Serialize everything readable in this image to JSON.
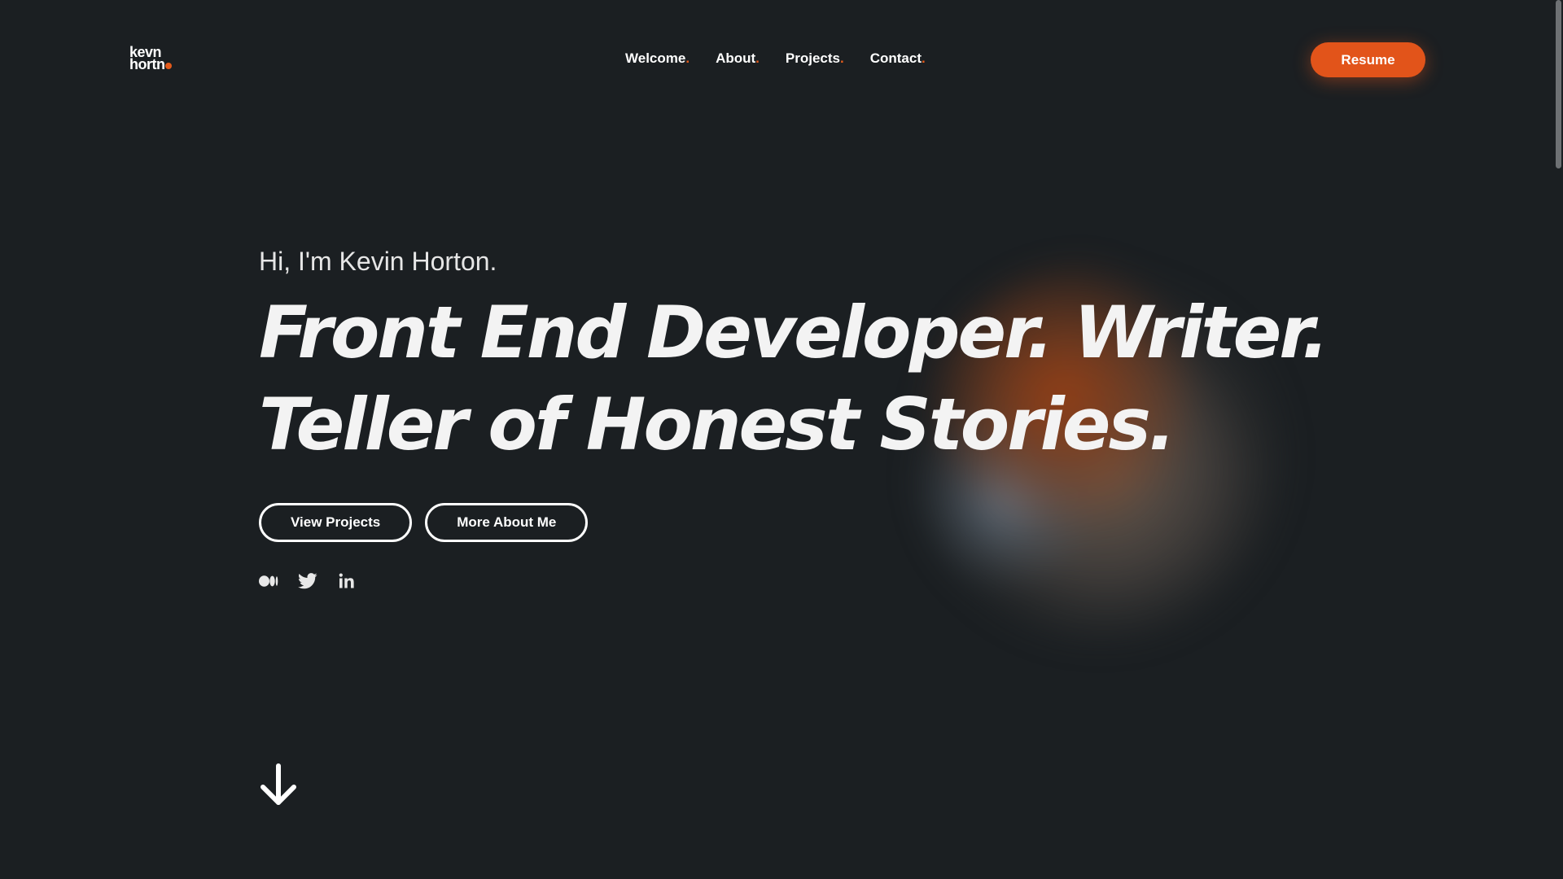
{
  "logo": {
    "line1": "kevn",
    "line2": "hortn"
  },
  "nav": {
    "items": [
      {
        "label": "Welcome",
        "period": "."
      },
      {
        "label": "About",
        "period": "."
      },
      {
        "label": "Projects",
        "period": "."
      },
      {
        "label": "Contact",
        "period": "."
      }
    ]
  },
  "header": {
    "resume_label": "Resume"
  },
  "hero": {
    "greeting": "Hi, I'm Kevin Horton.",
    "headline_line1": "Front End Developer. Writer.",
    "headline_line2": "Teller of Honest Stories.",
    "view_projects_label": "View Projects",
    "more_about_label": "More About Me"
  },
  "social": {
    "icons": [
      "medium-icon",
      "twitter-icon",
      "linkedin-icon"
    ]
  },
  "colors": {
    "background": "#1b1f22",
    "accent": "#e2541a",
    "text": "#ffffff"
  }
}
